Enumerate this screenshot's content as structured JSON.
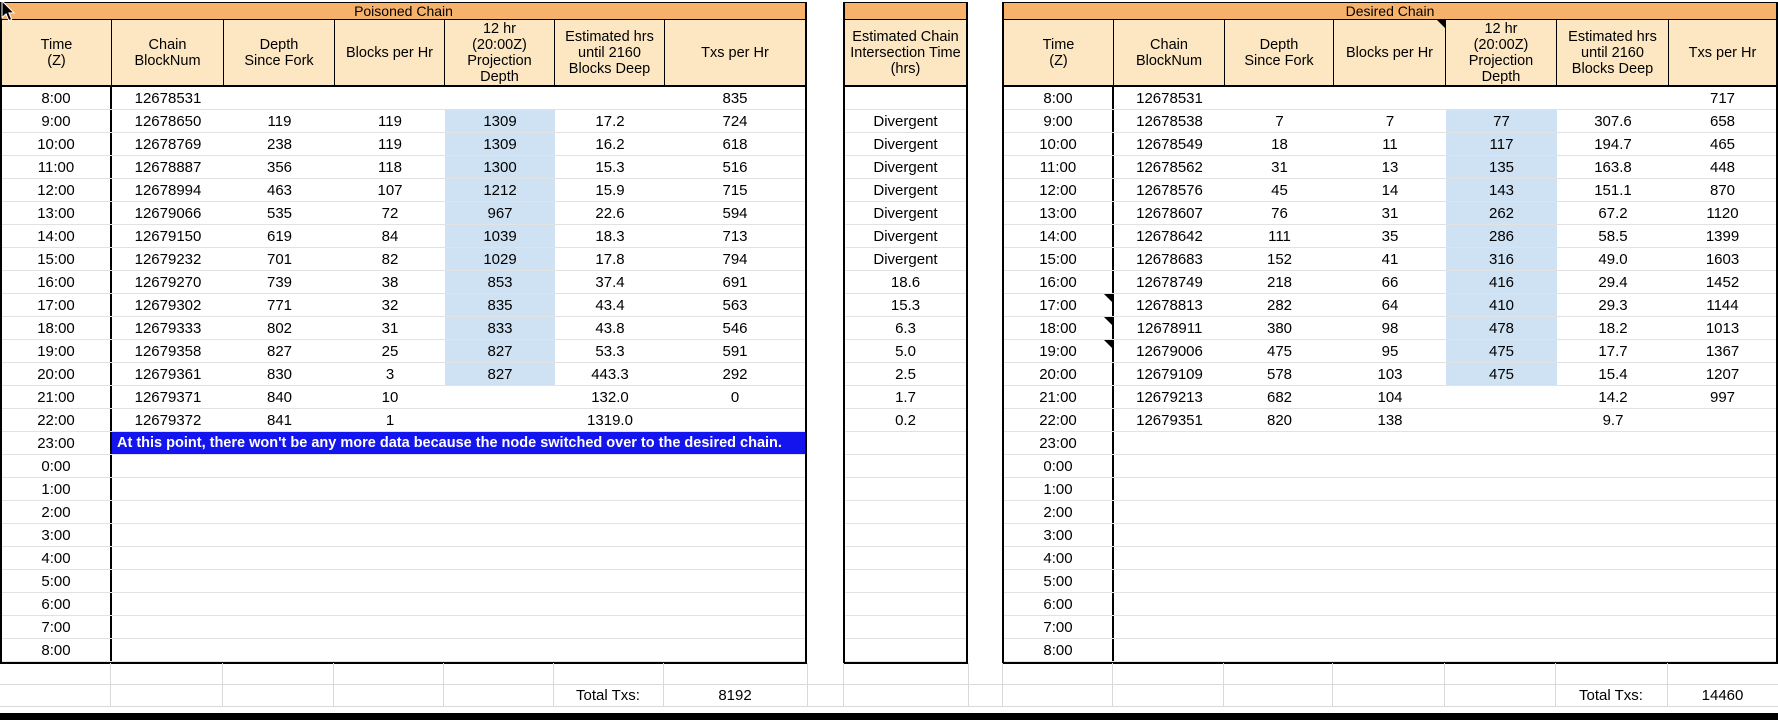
{
  "colors": {
    "band": "#F6B26B",
    "cream": "#FCE7C2",
    "highlight": "#CFE2F3",
    "message": "#1414EE",
    "grid": "#E2E2E2"
  },
  "times": [
    "8:00",
    "9:00",
    "10:00",
    "11:00",
    "12:00",
    "13:00",
    "14:00",
    "15:00",
    "16:00",
    "17:00",
    "18:00",
    "19:00",
    "20:00",
    "21:00",
    "22:00",
    "23:00",
    "0:00",
    "1:00",
    "2:00",
    "3:00",
    "4:00",
    "5:00",
    "6:00",
    "7:00",
    "8:00"
  ],
  "poisoned": {
    "title": "Poisoned Chain",
    "columns": [
      "Time\n(Z)",
      "Chain\nBlockNum",
      "Depth\nSince Fork",
      "Blocks per Hr",
      "12 hr\n(20:00Z)\nProjection\nDepth",
      "Estimated hrs\nuntil 2160\nBlocks Deep",
      "Txs per Hr"
    ],
    "rows": [
      [
        "12678531",
        "",
        "",
        "",
        "",
        "835"
      ],
      [
        "12678650",
        "119",
        "119",
        "1309",
        "17.2",
        "724"
      ],
      [
        "12678769",
        "238",
        "119",
        "1309",
        "16.2",
        "618"
      ],
      [
        "12678887",
        "356",
        "118",
        "1300",
        "15.3",
        "516"
      ],
      [
        "12678994",
        "463",
        "107",
        "1212",
        "15.9",
        "715"
      ],
      [
        "12679066",
        "535",
        "72",
        "967",
        "22.6",
        "594"
      ],
      [
        "12679150",
        "619",
        "84",
        "1039",
        "18.3",
        "713"
      ],
      [
        "12679232",
        "701",
        "82",
        "1029",
        "17.8",
        "794"
      ],
      [
        "12679270",
        "739",
        "38",
        "853",
        "37.4",
        "691"
      ],
      [
        "12679302",
        "771",
        "32",
        "835",
        "43.4",
        "563"
      ],
      [
        "12679333",
        "802",
        "31",
        "833",
        "43.8",
        "546"
      ],
      [
        "12679358",
        "827",
        "25",
        "827",
        "53.3",
        "591"
      ],
      [
        "12679361",
        "830",
        "3",
        "827",
        "443.3",
        "292"
      ],
      [
        "12679371",
        "840",
        "10",
        "",
        "132.0",
        "0"
      ],
      [
        "12679372",
        "841",
        "1",
        "",
        "1319.0",
        ""
      ]
    ],
    "highlight_rows": [
      1,
      2,
      3,
      4,
      5,
      6,
      7,
      8,
      9,
      10,
      11,
      12
    ],
    "message_row": 15,
    "message": "At this point, there won't be any more data because the node switched over to the desired chain.",
    "total_label": "Total Txs:",
    "total_value": "8192"
  },
  "intersection": {
    "header": "Estimated Chain\nIntersection Time\n(hrs)",
    "values": [
      "",
      "Divergent",
      "Divergent",
      "Divergent",
      "Divergent",
      "Divergent",
      "Divergent",
      "Divergent",
      "18.6",
      "15.3",
      "6.3",
      "5.0",
      "2.5",
      "1.7",
      "0.2",
      "",
      "",
      "",
      "",
      "",
      "",
      "",
      "",
      "",
      ""
    ]
  },
  "desired": {
    "title": "Desired Chain",
    "columns": [
      "Time\n(Z)",
      "Chain\nBlockNum",
      "Depth\nSince Fork",
      "Blocks per Hr",
      "12 hr\n(20:00Z)\nProjection\nDepth",
      "Estimated hrs\nuntil 2160\nBlocks Deep",
      "Txs per Hr"
    ],
    "header_comment_col": 3,
    "rows": [
      [
        "12678531",
        "",
        "",
        "",
        "",
        "717"
      ],
      [
        "12678538",
        "7",
        "7",
        "77",
        "307.6",
        "658"
      ],
      [
        "12678549",
        "18",
        "11",
        "117",
        "194.7",
        "465"
      ],
      [
        "12678562",
        "31",
        "13",
        "135",
        "163.8",
        "448"
      ],
      [
        "12678576",
        "45",
        "14",
        "143",
        "151.1",
        "870"
      ],
      [
        "12678607",
        "76",
        "31",
        "262",
        "67.2",
        "1120"
      ],
      [
        "12678642",
        "111",
        "35",
        "286",
        "58.5",
        "1399"
      ],
      [
        "12678683",
        "152",
        "41",
        "316",
        "49.0",
        "1603"
      ],
      [
        "12678749",
        "218",
        "66",
        "416",
        "29.4",
        "1452"
      ],
      [
        "12678813",
        "282",
        "64",
        "410",
        "29.3",
        "1144"
      ],
      [
        "12678911",
        "380",
        "98",
        "478",
        "18.2",
        "1013"
      ],
      [
        "12679006",
        "475",
        "95",
        "475",
        "17.7",
        "1367"
      ],
      [
        "12679109",
        "578",
        "103",
        "475",
        "15.4",
        "1207"
      ],
      [
        "12679213",
        "682",
        "104",
        "",
        "14.2",
        "997"
      ],
      [
        "12679351",
        "820",
        "138",
        "",
        "9.7",
        ""
      ]
    ],
    "highlight_rows": [
      1,
      2,
      3,
      4,
      5,
      6,
      7,
      8,
      9,
      10,
      11,
      12
    ],
    "comment_rows": [
      9,
      10,
      11
    ],
    "total_label": "Total Txs:",
    "total_value": "14460"
  }
}
